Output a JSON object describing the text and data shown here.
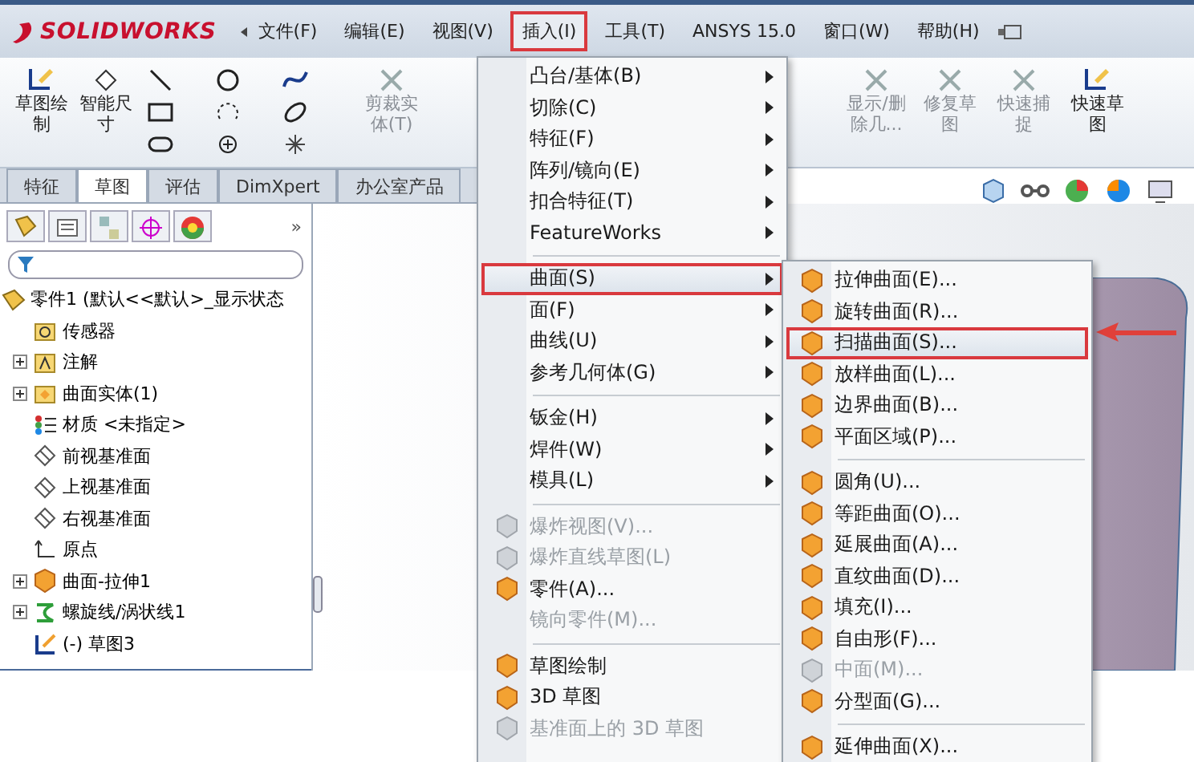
{
  "menubar": {
    "logo": "SOLIDWORKS",
    "items": [
      {
        "label": "文件(F)",
        "selected": false
      },
      {
        "label": "编辑(E)",
        "selected": false
      },
      {
        "label": "视图(V)",
        "selected": false
      },
      {
        "label": "插入(I)",
        "selected": true
      },
      {
        "label": "工具(T)",
        "selected": false
      },
      {
        "label": "ANSYS 15.0",
        "selected": false
      },
      {
        "label": "窗口(W)",
        "selected": false
      },
      {
        "label": "帮助(H)",
        "selected": false
      }
    ]
  },
  "ribbon": {
    "left": [
      {
        "label": "草图绘制",
        "disabled": false
      },
      {
        "label": "智能尺寸",
        "disabled": false
      },
      {
        "label": "剪裁实体(T)",
        "disabled": true
      }
    ],
    "right": [
      {
        "label": "显示/删除几...",
        "disabled": true
      },
      {
        "label": "修复草图",
        "disabled": true
      },
      {
        "label": "快速捕捉",
        "disabled": true
      },
      {
        "label": "快速草图",
        "disabled": false
      }
    ]
  },
  "tabs": [
    {
      "label": "特征",
      "selected": false
    },
    {
      "label": "草图",
      "selected": true
    },
    {
      "label": "评估",
      "selected": false
    },
    {
      "label": "DimXpert",
      "selected": false
    },
    {
      "label": "办公室产品",
      "selected": false
    }
  ],
  "left_panel": {
    "more": "»",
    "tree": {
      "label": "零件1  (默认<<默认>_显示状态",
      "children": [
        {
          "label": "传感器",
          "collapsed": false
        },
        {
          "label": "注解",
          "collapsed": true
        },
        {
          "label": "曲面实体(1)",
          "collapsed": true
        },
        {
          "label": "材质 <未指定>",
          "collapsed": false
        },
        {
          "label": "前视基准面",
          "collapsed": false
        },
        {
          "label": "上视基准面",
          "collapsed": false
        },
        {
          "label": "右视基准面",
          "collapsed": false
        },
        {
          "label": "原点",
          "collapsed": false
        },
        {
          "label": "曲面-拉伸1",
          "collapsed": true
        },
        {
          "label": "螺旋线/涡状线1",
          "collapsed": true
        },
        {
          "label": "(-) 草图3",
          "collapsed": false
        }
      ]
    }
  },
  "insert_menu": {
    "groups": [
      [
        {
          "label": "凸台/基体(B)",
          "submenu": true,
          "disabled": false,
          "selected": false,
          "has_icon": false
        },
        {
          "label": "切除(C)",
          "submenu": true,
          "disabled": false,
          "selected": false,
          "has_icon": false
        },
        {
          "label": "特征(F)",
          "submenu": true,
          "disabled": false,
          "selected": false,
          "has_icon": false
        },
        {
          "label": "阵列/镜向(E)",
          "submenu": true,
          "disabled": false,
          "selected": false,
          "has_icon": false
        },
        {
          "label": "扣合特征(T)",
          "submenu": true,
          "disabled": false,
          "selected": false,
          "has_icon": false
        },
        {
          "label": "FeatureWorks",
          "submenu": true,
          "disabled": false,
          "selected": false,
          "has_icon": false
        }
      ],
      [
        {
          "label": "曲面(S)",
          "submenu": true,
          "disabled": false,
          "selected": true,
          "has_icon": false
        },
        {
          "label": "面(F)",
          "submenu": true,
          "disabled": false,
          "selected": false,
          "has_icon": false
        },
        {
          "label": "曲线(U)",
          "submenu": true,
          "disabled": false,
          "selected": false,
          "has_icon": false
        },
        {
          "label": "参考几何体(G)",
          "submenu": true,
          "disabled": false,
          "selected": false,
          "has_icon": false
        }
      ],
      [
        {
          "label": "钣金(H)",
          "submenu": true,
          "disabled": false,
          "selected": false,
          "has_icon": false
        },
        {
          "label": "焊件(W)",
          "submenu": true,
          "disabled": false,
          "selected": false,
          "has_icon": false
        },
        {
          "label": "模具(L)",
          "submenu": true,
          "disabled": false,
          "selected": false,
          "has_icon": false
        }
      ],
      [
        {
          "label": "爆炸视图(V)...",
          "submenu": false,
          "disabled": true,
          "selected": false,
          "has_icon": true
        },
        {
          "label": "爆炸直线草图(L)",
          "submenu": false,
          "disabled": true,
          "selected": false,
          "has_icon": true
        },
        {
          "label": "零件(A)...",
          "submenu": false,
          "disabled": false,
          "selected": false,
          "has_icon": true
        },
        {
          "label": "镜向零件(M)...",
          "submenu": false,
          "disabled": true,
          "selected": false,
          "has_icon": false
        }
      ],
      [
        {
          "label": "草图绘制",
          "submenu": false,
          "disabled": false,
          "selected": false,
          "has_icon": true
        },
        {
          "label": "3D 草图",
          "submenu": false,
          "disabled": false,
          "selected": false,
          "has_icon": true
        },
        {
          "label": "基准面上的 3D 草图",
          "submenu": false,
          "disabled": true,
          "selected": false,
          "has_icon": true
        }
      ]
    ]
  },
  "surface_menu": {
    "groups": [
      [
        {
          "label": "拉伸曲面(E)...",
          "submenu": false,
          "disabled": false,
          "selected": false,
          "has_icon": true
        },
        {
          "label": "旋转曲面(R)...",
          "submenu": false,
          "disabled": false,
          "selected": false,
          "has_icon": true
        },
        {
          "label": "扫描曲面(S)...",
          "submenu": false,
          "disabled": false,
          "selected": true,
          "has_icon": true
        },
        {
          "label": "放样曲面(L)...",
          "submenu": false,
          "disabled": false,
          "selected": false,
          "has_icon": true
        },
        {
          "label": "边界曲面(B)...",
          "submenu": false,
          "disabled": false,
          "selected": false,
          "has_icon": true
        },
        {
          "label": "平面区域(P)...",
          "submenu": false,
          "disabled": false,
          "selected": false,
          "has_icon": true
        }
      ],
      [
        {
          "label": "圆角(U)...",
          "submenu": false,
          "disabled": false,
          "selected": false,
          "has_icon": true
        },
        {
          "label": "等距曲面(O)...",
          "submenu": false,
          "disabled": false,
          "selected": false,
          "has_icon": true
        },
        {
          "label": "延展曲面(A)...",
          "submenu": false,
          "disabled": false,
          "selected": false,
          "has_icon": true
        },
        {
          "label": "直纹曲面(D)...",
          "submenu": false,
          "disabled": false,
          "selected": false,
          "has_icon": true
        },
        {
          "label": "填充(I)...",
          "submenu": false,
          "disabled": false,
          "selected": false,
          "has_icon": true
        },
        {
          "label": "自由形(F)...",
          "submenu": false,
          "disabled": false,
          "selected": false,
          "has_icon": true
        },
        {
          "label": "中面(M)...",
          "submenu": false,
          "disabled": true,
          "selected": false,
          "has_icon": true
        },
        {
          "label": "分型面(G)...",
          "submenu": false,
          "disabled": false,
          "selected": false,
          "has_icon": true
        }
      ],
      [
        {
          "label": "延伸曲面(X)...",
          "submenu": false,
          "disabled": false,
          "selected": false,
          "has_icon": true
        }
      ]
    ]
  }
}
